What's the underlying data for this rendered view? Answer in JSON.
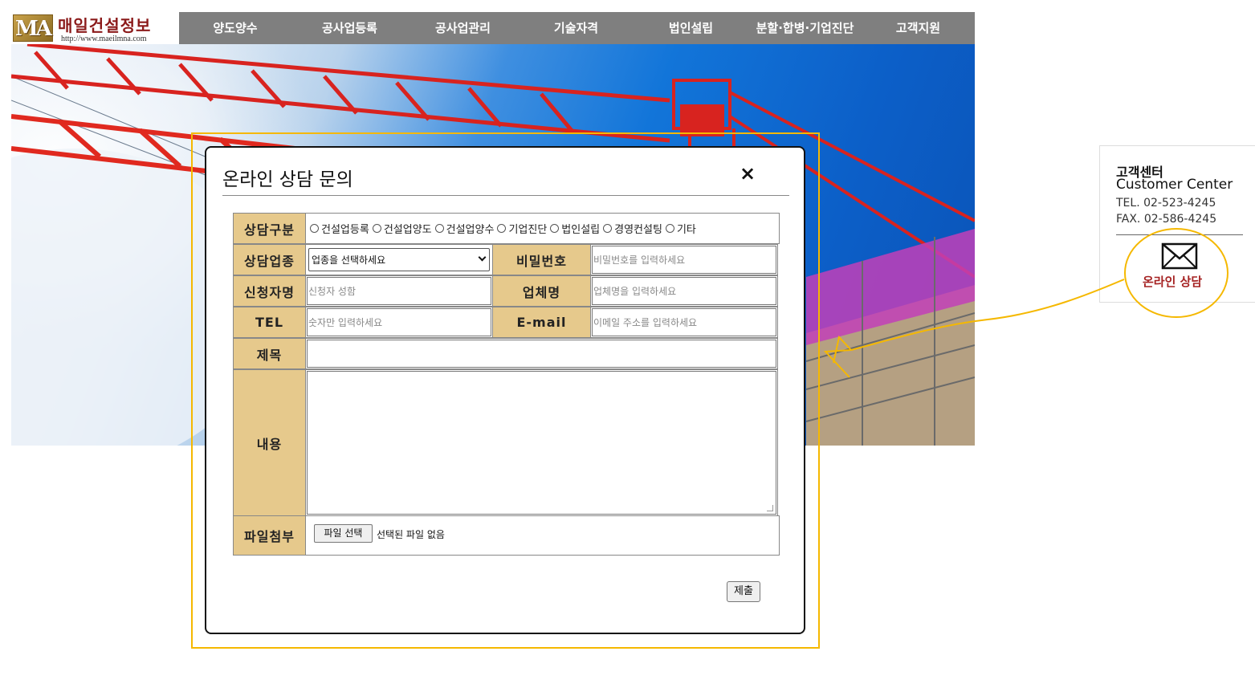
{
  "header": {
    "logo_mark": "MA",
    "logo_name": "매일건설정보",
    "logo_url": "http://www.maeilmna.com",
    "nav": [
      "양도양수",
      "공사업등록",
      "공사업관리",
      "기술자격",
      "법인설립",
      "분할·합병·기업진단",
      "고객지원"
    ]
  },
  "modal": {
    "title": "온라인 상담 문의",
    "close_icon": "×",
    "labels": {
      "category": "상담구분",
      "business": "상담업종",
      "password": "비밀번호",
      "applicant": "신청자명",
      "company": "업체명",
      "tel": "TEL",
      "email": "E-mail",
      "subject": "제목",
      "content": "내용",
      "attachment": "파일첨부"
    },
    "category_options": [
      "건설업등록",
      "건설업양도",
      "건설업양수",
      "기업진단",
      "법인설립",
      "경영컨설팅",
      "기타"
    ],
    "business_select": "업종을 선택하세요",
    "placeholders": {
      "password": "비밀번호를 입력하세요",
      "applicant": "신청자 성함",
      "company": "업체명을 입력하세요",
      "tel": "숫자만 입력하세요",
      "email": "이메일 주소를 입력하세요"
    },
    "file_button": "파일 선택",
    "file_status": "선택된 파일 없음",
    "submit": "제출"
  },
  "customer_center": {
    "title_ko": "고객센터",
    "title_en": "Customer Center",
    "tel": "TEL. 02-523-4245",
    "fax": "FAX. 02-586-4245",
    "icon": "envelope-icon",
    "link": "온라인 상담"
  },
  "colors": {
    "nav_bg": "#7f7f7f",
    "label_bg": "#e6c98c",
    "highlight": "#f5b800",
    "link": "#a52222"
  }
}
